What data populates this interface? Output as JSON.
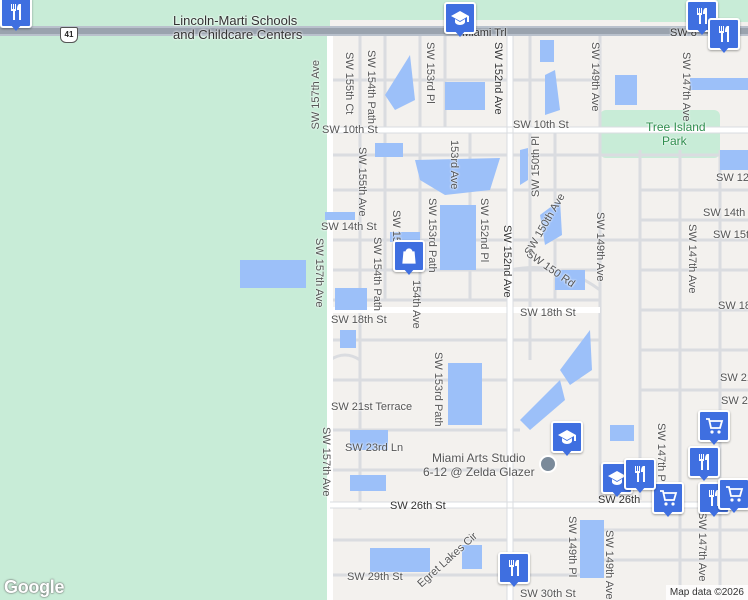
{
  "map": {
    "highway_shield": "41",
    "labels": {
      "school_top_line1": "Lincoln-Marti Schools",
      "school_top_line2": "and Childcare Centers",
      "miami_trl": "Miami Trl",
      "sw_8": "SW 8",
      "tree_island_line1": "Tree Island",
      "tree_island_line2": "Park",
      "sw_10th_a": "SW 10th St",
      "sw_10th_b": "SW 10th St",
      "sw_12th": "SW 12th",
      "sw_14th_a": "SW 14th St",
      "sw_14th_b": "SW 14th St",
      "sw_15th": "SW 15th",
      "sw_18th_a": "SW 18th St",
      "sw_18th_b": "SW 18th St",
      "sw_18_partial": "SW 18",
      "sw_21": "SW 21",
      "sw_22": "SW 22",
      "sw_21st_terrace": "SW 21st Terrace",
      "sw_23rd": "SW 23rd Ln",
      "sw_26th_a": "SW 26th St",
      "sw_26th_b": "SW 26th",
      "sw_29th": "SW 29th St",
      "sw_30th": "SW 30th St",
      "egret": "Egret Lakes Cir",
      "miami_arts_line1": "Miami Arts Studio",
      "miami_arts_line2": "6-12 @ Zelda Glazer",
      "sw_157th_a": "SW 157th Ave",
      "sw_157th_b": "SW 157th Ave",
      "sw_157th_c": "SW 157th Ave",
      "sw_156th": "SW 156th Ave",
      "sw_155th_ct": "SW 155th Ct",
      "sw_154th_path_a": "SW 154th Path",
      "sw_155th_ave": "SW 155th Ave",
      "sw_154th_path_b": "SW 154th Path",
      "sw_153rd_pl": "SW 153rd Pl",
      "sw_152nd_a": "SW 152nd Ave",
      "sw_152nd_b": "SW 152nd Ave",
      "sw_150th_pl": "SW 150th Pl",
      "sw_149th_a": "SW 149th Ave",
      "sw_149th_b": "SW 149th Ave",
      "sw_149th_pl": "SW 149th Pl",
      "sw_147th_a": "SW 147th Ave",
      "sw_147th_b": "SW 147th Ave",
      "sw_147th_c": "SW 147th Ave",
      "sw_147th_path": "SW 147th Path",
      "ave_153rd": "153rd Ave",
      "sw_153rd_path_a": "SW 153rd Path",
      "sw_153rd_path_b": "SW 153rd Path",
      "sw_152nd_pl": "SW 152nd Pl",
      "sw_150th_ave": "SW 150th Ave",
      "sw_150_rd": "SW 150 Rd",
      "sw_15x": "SW 15",
      "ave_154th": "154th Ave"
    },
    "pins": [
      {
        "kind": "restaurant-icon"
      },
      {
        "kind": "school-icon"
      },
      {
        "kind": "shopping-bag-icon"
      },
      {
        "kind": "school-icon"
      },
      {
        "kind": "school-icon"
      },
      {
        "kind": "grocery-cart-icon"
      },
      {
        "kind": "restaurant-icon"
      },
      {
        "kind": "restaurant-icon"
      }
    ],
    "attribution": "Map data ©2026",
    "logo": "Google",
    "colors": {
      "water": "#9cc0f9",
      "park": "#c8ecd7",
      "pin": "#3f6fe0",
      "road": "#ffffff",
      "minor_road": "#dadce0"
    }
  }
}
